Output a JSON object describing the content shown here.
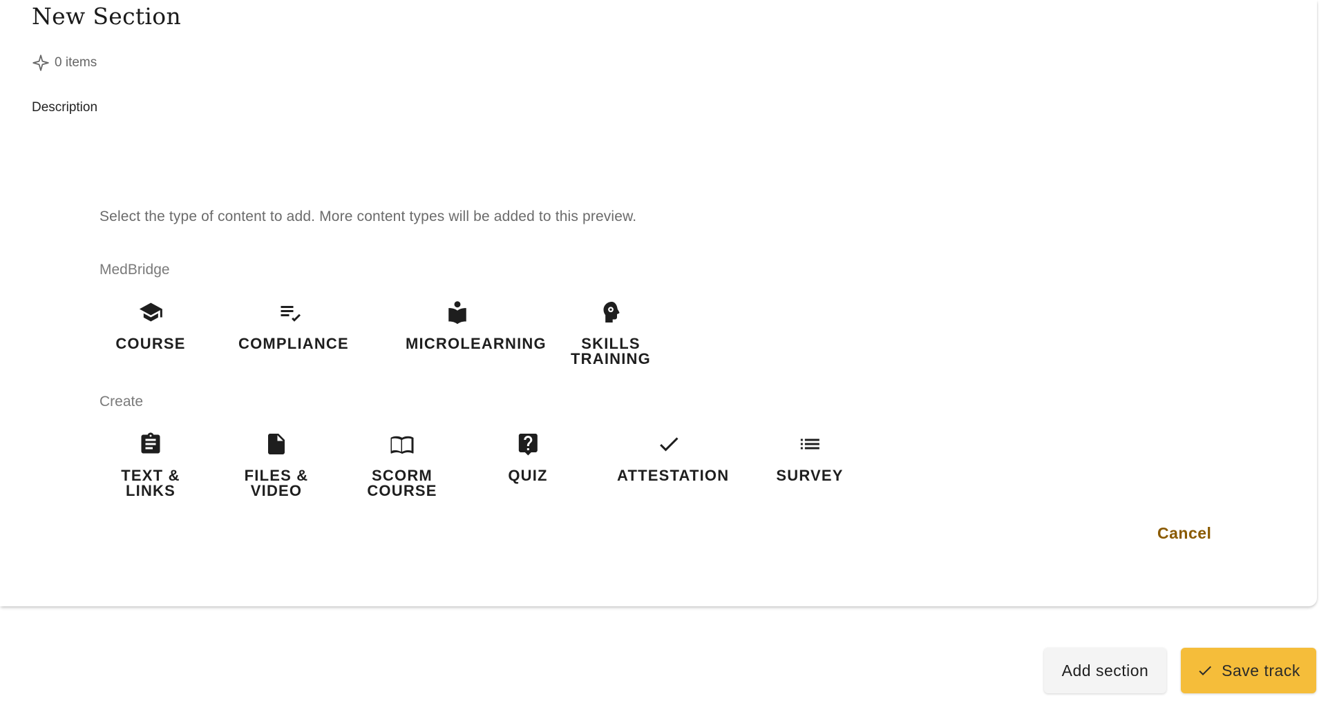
{
  "section": {
    "title": "New Section",
    "items_count": "0 items",
    "description_label": "Description"
  },
  "picker": {
    "instruction": "Select the type of content to add. More content types will be added to this preview.",
    "groups": [
      {
        "label": "MedBridge",
        "items": [
          {
            "label": "COURSE",
            "icon": "graduation-cap-icon"
          },
          {
            "label": "COMPLIANCE",
            "icon": "checklist-icon"
          },
          {
            "label": "MICROLEARNING",
            "icon": "person-reading-icon"
          },
          {
            "label": "SKILLS TRAINING",
            "icon": "head-gear-icon"
          }
        ]
      },
      {
        "label": "Create",
        "items": [
          {
            "label": "TEXT & LINKS",
            "icon": "clipboard-text-icon"
          },
          {
            "label": "FILES & VIDEO",
            "icon": "file-icon"
          },
          {
            "label": "SCORM COURSE",
            "icon": "open-book-icon"
          },
          {
            "label": "QUIZ",
            "icon": "question-bubble-icon"
          },
          {
            "label": "ATTESTATION",
            "icon": "check-icon"
          },
          {
            "label": "SURVEY",
            "icon": "list-icon"
          }
        ]
      }
    ],
    "cancel_label": "Cancel"
  },
  "footer": {
    "add_section_label": "Add section",
    "save_track_label": "Save track"
  },
  "colors": {
    "accent": "#f5bd3a",
    "cancel_text": "#8a5a00",
    "muted_text": "#6b6b6b"
  }
}
